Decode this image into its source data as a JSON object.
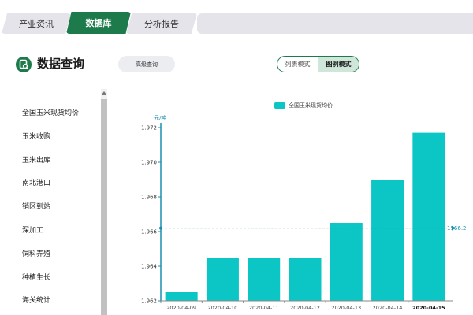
{
  "tabs": [
    {
      "label": "产业资讯",
      "active": false
    },
    {
      "label": "数据库",
      "active": true
    },
    {
      "label": "分析报告",
      "active": false
    }
  ],
  "header": {
    "title": "数据查询",
    "advanced_button": "高级查询",
    "modes": [
      {
        "label": "列表模式",
        "active": false
      },
      {
        "label": "图例模式",
        "active": true
      }
    ]
  },
  "sidebar": {
    "items": [
      "全国玉米现货均价",
      "玉米收购",
      "玉米出库",
      "南北港口",
      "销区到站",
      "深加工",
      "饲料养殖",
      "种植生长",
      "海关统计"
    ]
  },
  "colors": {
    "brand": "#1d7a4a",
    "bar": "#0cc6c6",
    "axis": "#1a8fb0"
  },
  "chart_data": {
    "type": "bar",
    "title": "",
    "legend": "全国玉米现货均价",
    "ylabel": "元/吨",
    "xlabel": "",
    "categories": [
      "2020-04-09",
      "2020-04-10",
      "2020-04-11",
      "2020-04-12",
      "2020-04-13",
      "2020-04-14",
      "2020-04-15"
    ],
    "series": [
      {
        "name": "全国玉米现货均价",
        "values": [
          1962.5,
          1964.5,
          1964.5,
          1964.5,
          1966.5,
          1969.0,
          1971.7
        ]
      }
    ],
    "ylim": [
      1962,
      1972
    ],
    "yticks": [
      "1.962",
      "1.964",
      "1.966",
      "1.968",
      "1.970",
      "1.972"
    ],
    "average_line": {
      "value": 1966.2,
      "label": "1966.2"
    },
    "highlight_category": "2020-04-15"
  }
}
